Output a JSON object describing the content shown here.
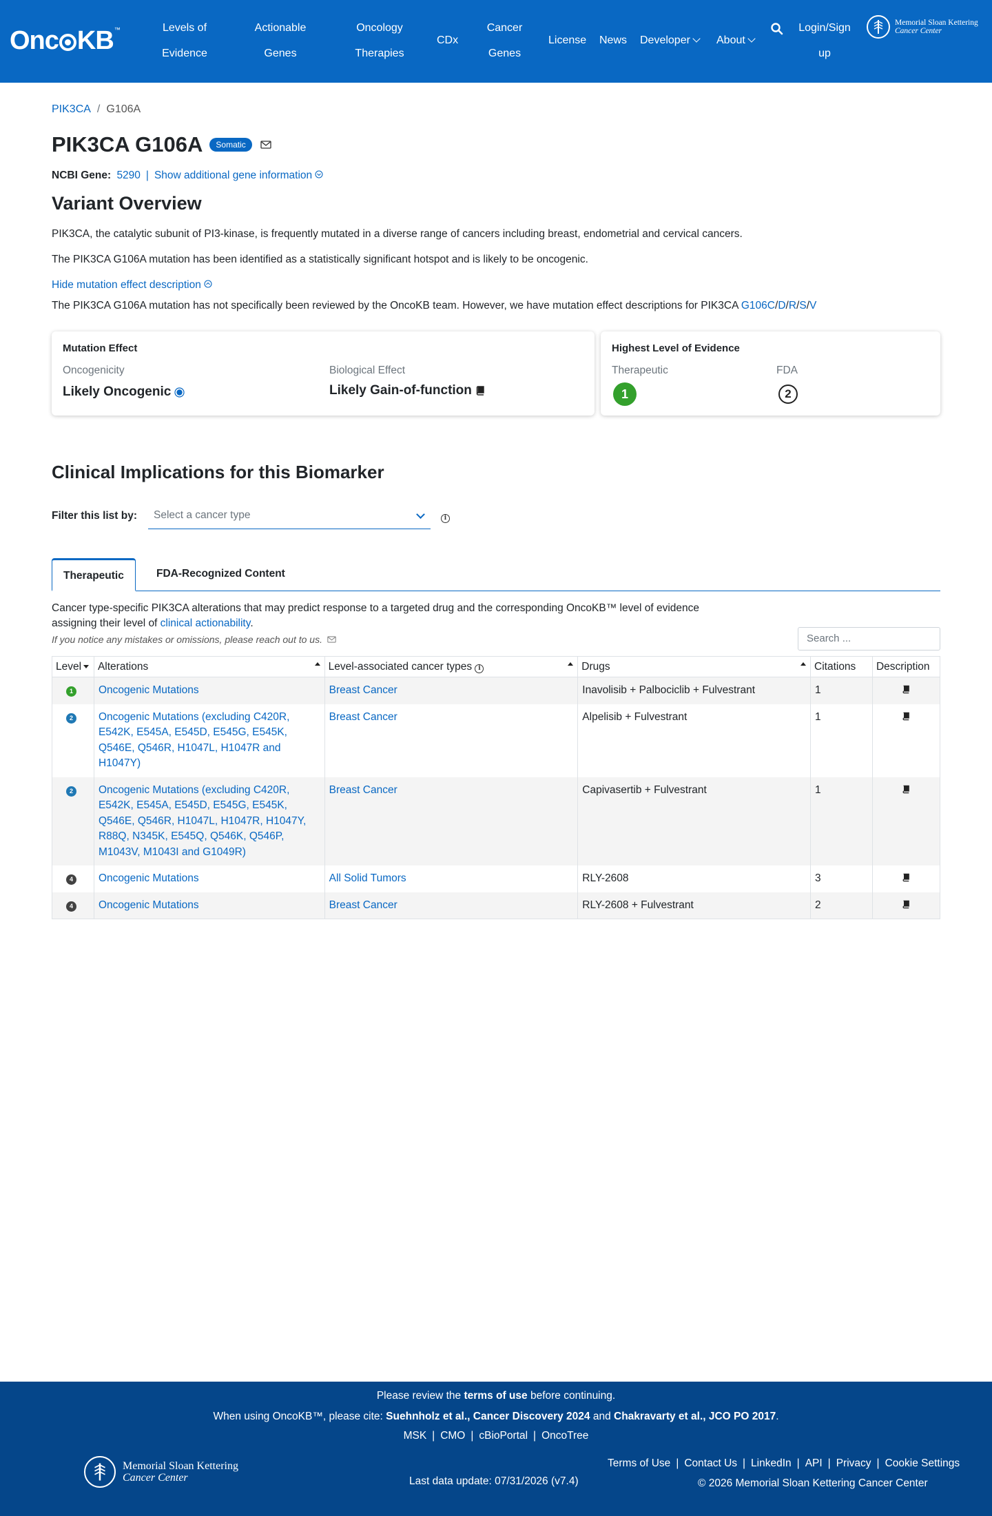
{
  "nav": {
    "brand": "OncoKB",
    "brand_tm": "™",
    "items": [
      {
        "label_1": "Levels of",
        "label_2": "Evidence"
      },
      {
        "label_1": "Actionable",
        "label_2": "Genes"
      },
      {
        "label_1": "Oncology",
        "label_2": "Therapies"
      },
      {
        "label_1": "CDx"
      },
      {
        "label_1": "Cancer",
        "label_2": "Genes"
      },
      {
        "label_1": "License"
      },
      {
        "label_1": "News"
      },
      {
        "label_1": "Developer"
      },
      {
        "label_1": "About"
      }
    ],
    "login_1": "Login/Sign",
    "login_2": "up",
    "msk_line1": "Memorial Sloan Kettering",
    "msk_line2": "Cancer Center"
  },
  "breadcrumb": {
    "gene": "PIK3CA",
    "sep": "/",
    "variant": "G106A"
  },
  "title": {
    "text": "PIK3CA G106A",
    "badge": "Somatic"
  },
  "gene_info": {
    "label": "NCBI Gene:",
    "id": "5290",
    "sep": "|",
    "more_link": "Show additional gene information"
  },
  "overview": {
    "title": "Variant Overview",
    "p1": "PIK3CA, the catalytic subunit of PI3-kinase, is frequently mutated in a diverse range of cancers including breast, endometrial and cervical cancers.",
    "p2": "The PIK3CA G106A mutation has been identified as a statistically significant hotspot and is likely to be oncogenic.",
    "toggle": "Hide mutation effect description",
    "p3": "The PIK3CA G106A mutation has not specifically been reviewed by the OncoKB team. However, we have mutation effect descriptions for PIK3CA ",
    "p3_links": [
      "G106C",
      "D",
      "R",
      "S",
      "V"
    ],
    "p3_sep": "/"
  },
  "mutation_effect": {
    "title": "Mutation Effect",
    "onc_label": "Oncogenicity",
    "onc_value": "Likely Oncogenic",
    "bio_label": "Biological Effect",
    "bio_value": "Likely Gain-of-function"
  },
  "highest_level": {
    "title": "Highest Level of Evidence",
    "ther_label": "Therapeutic",
    "ther_value": "1",
    "fda_label": "FDA",
    "fda_value": "2"
  },
  "clinical": {
    "title": "Clinical Implications for this Biomarker",
    "filter_label": "Filter this list by:",
    "filter_placeholder": "Select a cancer type",
    "tabs": [
      "Therapeutic",
      "FDA-Recognized Content"
    ],
    "desc_1": "Cancer type-specific PIK3CA alterations that may predict response to a targeted drug and the corresponding OncoKB™ level of evidence",
    "desc_2": "assigning their level of ",
    "desc_link": "clinical actionability",
    "desc_end": ".",
    "notice": "If you notice any mistakes or omissions, please reach out to us.",
    "search_placeholder": "Search ...",
    "columns": [
      "Level",
      "Alterations",
      "Level-associated cancer types",
      "Drugs",
      "Citations",
      "Description"
    ],
    "rows": [
      {
        "level": "1",
        "level_color": "#33a02c",
        "alteration": "Oncogenic Mutations",
        "cancer": "Breast Cancer",
        "drugs": "Inavolisib + Palbociclib + Fulvestrant",
        "citations": "1"
      },
      {
        "level": "2",
        "level_color": "#1f78b4",
        "alteration": "Oncogenic Mutations (excluding C420R, E542K, E545A, E545D, E545G, E545K, Q546E, Q546R, H1047L, H1047R and H1047Y)",
        "cancer": "Breast Cancer",
        "drugs": "Alpelisib + Fulvestrant",
        "citations": "1"
      },
      {
        "level": "2",
        "level_color": "#1f78b4",
        "alteration": "Oncogenic Mutations (excluding C420R, E542K, E545A, E545D, E545G, E545K, Q546E, Q546R, H1047L, H1047R, H1047Y, R88Q, N345K, E545Q, Q546K, Q546P, M1043V, M1043I and G1049R)",
        "cancer": "Breast Cancer",
        "drugs": "Capivasertib + Fulvestrant",
        "citations": "1"
      },
      {
        "level": "4",
        "level_color": "#424242",
        "alteration": "Oncogenic Mutations",
        "cancer": "All Solid Tumors",
        "drugs": "RLY-2608",
        "citations": "3"
      },
      {
        "level": "4",
        "level_color": "#424242",
        "alteration": "Oncogenic Mutations",
        "cancer": "Breast Cancer",
        "drugs": "RLY-2608 + Fulvestrant",
        "citations": "2"
      }
    ]
  },
  "footer": {
    "terms_pre": "Please review the ",
    "terms_bold": "terms of use",
    "terms_post": " before continuing.",
    "cite_pre": "When using OncoKB™, please cite: ",
    "cite_1": "Suehnholz et al., Cancer Discovery 2024",
    "cite_and": " and ",
    "cite_2": "Chakravarty et al., JCO PO 2017",
    "cite_end": ".",
    "links": [
      "MSK",
      "CMO",
      "cBioPortal",
      "OncoTree"
    ],
    "last_update": "Last data update: 07/31/2026 (v7.4)",
    "right_links": [
      "Terms of Use",
      "Contact Us",
      "LinkedIn",
      "API",
      "Privacy",
      "Cookie Settings"
    ],
    "copyright": "© 2026 Memorial Sloan Kettering Cancer Center",
    "msk_line1": "Memorial Sloan Kettering",
    "msk_line2": "Cancer Center"
  },
  "colors": {
    "primary": "#0968c3",
    "footer": "#05468a",
    "level1": "#33a02c",
    "level2": "#1f78b4",
    "level4": "#424242"
  }
}
